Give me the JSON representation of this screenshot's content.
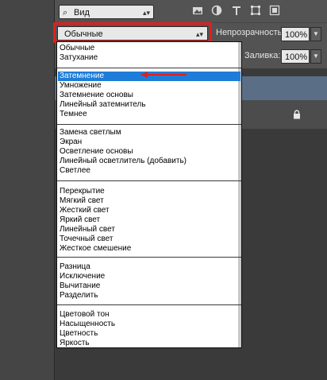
{
  "toolbar": {
    "kind_label": "Вид",
    "icons": [
      "image-filter-icon",
      "adjustment-filter-icon",
      "type-filter-icon",
      "shape-filter-icon",
      "smart-object-filter-icon"
    ]
  },
  "blend": {
    "current": "Обычные",
    "opacity_label": "Непрозрачность:",
    "opacity_value": "100%",
    "fill_label": "Заливка:",
    "fill_value": "100%"
  },
  "dropdown": {
    "selected": "Затемнение",
    "groups": [
      [
        "Обычные",
        "Затухание"
      ],
      [
        "Затемнение",
        "Умножение",
        "Затемнение основы",
        "Линейный затемнитель",
        "Темнее"
      ],
      [
        "Замена светлым",
        "Экран",
        "Осветление основы",
        "Линейный осветлитель (добавить)",
        "Светлее"
      ],
      [
        "Перекрытие",
        "Мягкий свет",
        "Жесткий свет",
        "Яркий свет",
        "Линейный свет",
        "Точечный свет",
        "Жесткое смешение"
      ],
      [
        "Разница",
        "Исключение",
        "Вычитание",
        "Разделить"
      ],
      [
        "Цветовой тон",
        "Насыщенность",
        "Цветность",
        "Яркость"
      ]
    ]
  },
  "colors": {
    "highlight_red": "#e0201c",
    "selection_blue": "#1e7dd8",
    "panel_gray": "#535353"
  }
}
